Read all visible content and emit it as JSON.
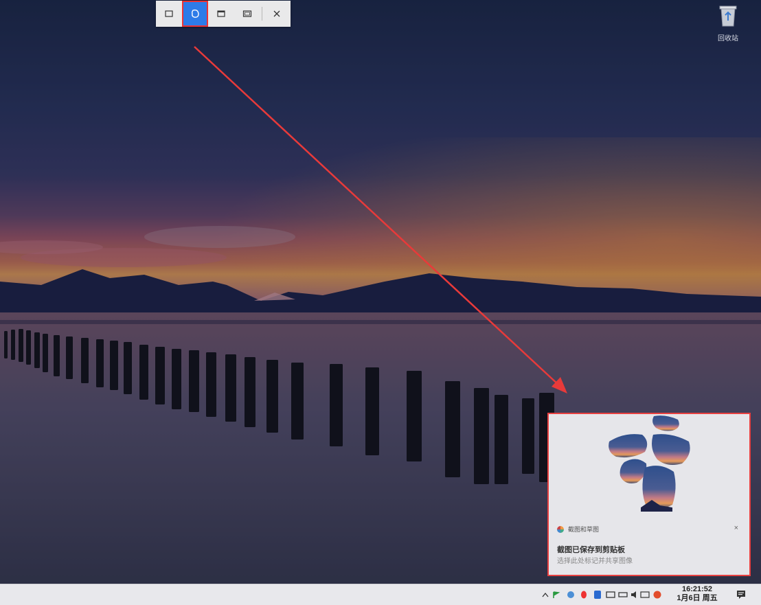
{
  "snip_toolbar": {
    "buttons": [
      {
        "id": "rect",
        "icon": "rectangle-snip-icon",
        "active": false
      },
      {
        "id": "freeform",
        "icon": "freeform-snip-icon",
        "active": true
      },
      {
        "id": "window",
        "icon": "window-snip-icon",
        "active": false
      },
      {
        "id": "fullscreen",
        "icon": "fullscreen-snip-icon",
        "active": false
      }
    ],
    "close_icon": "close-icon"
  },
  "desktop": {
    "recycle_bin": {
      "label": "回收站",
      "icon": "recycle-bin-icon"
    }
  },
  "notification": {
    "app_name": "截图和草图",
    "title": "截图已保存到剪贴板",
    "body": "选择此处标记并共享图像",
    "close_symbol": "×"
  },
  "taskbar": {
    "tray_icons": [
      "chevron-up-icon",
      "flag-icon",
      "shield-icon",
      "qq-icon",
      "bluetooth-icon",
      "printer-icon",
      "network-icon",
      "volume-icon",
      "keyboard-icon",
      "security-icon"
    ],
    "clock": {
      "time": "16:21:52",
      "date": "1月6日 周五"
    },
    "notification_center_icon": "action-center-icon"
  },
  "colors": {
    "accent": "#2d7be8",
    "highlight": "#e84040"
  }
}
